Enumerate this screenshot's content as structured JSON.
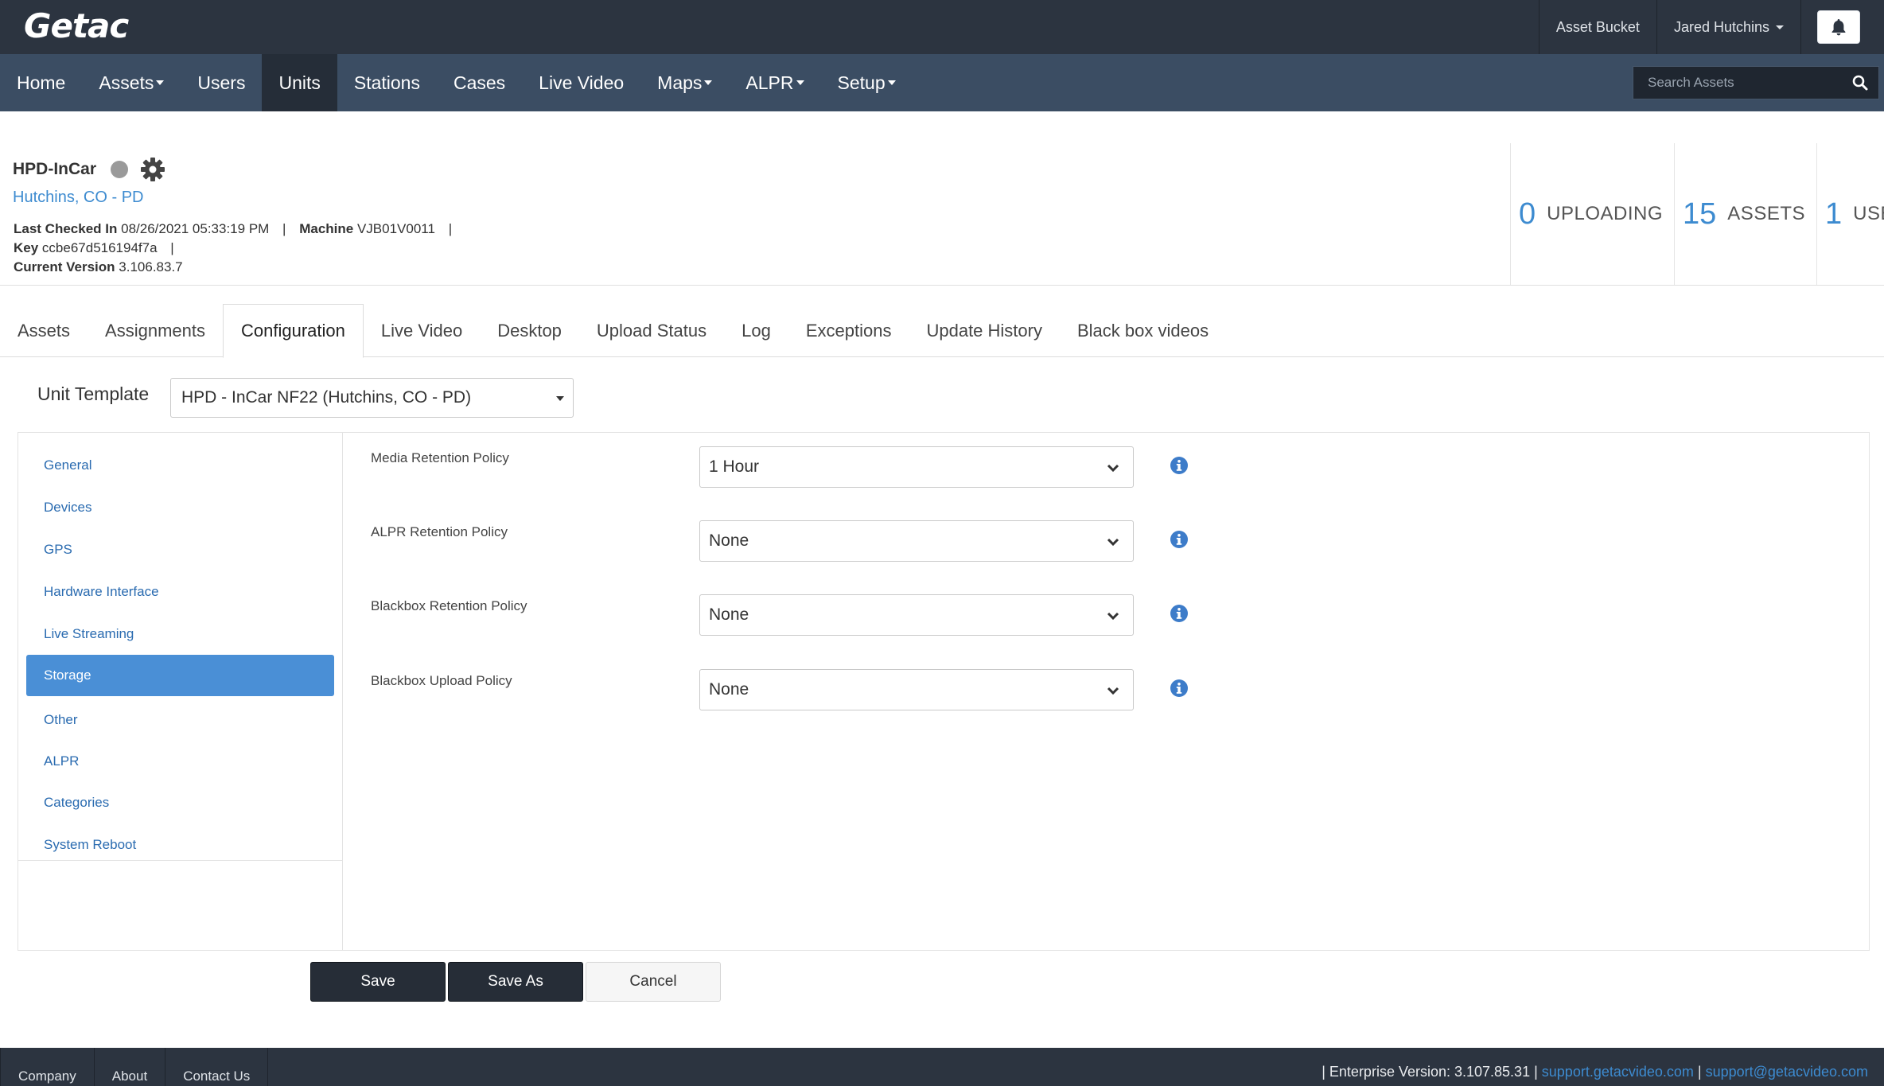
{
  "brand": {
    "logo": "Getac"
  },
  "topbar": {
    "asset_bucket": "Asset Bucket",
    "user_name": "Jared Hutchins",
    "bell_icon": "bell-icon"
  },
  "nav": {
    "items": [
      {
        "label": "Home",
        "dropdown": false,
        "active": false
      },
      {
        "label": "Assets",
        "dropdown": true,
        "active": false
      },
      {
        "label": "Users",
        "dropdown": false,
        "active": false
      },
      {
        "label": "Units",
        "dropdown": false,
        "active": true
      },
      {
        "label": "Stations",
        "dropdown": false,
        "active": false
      },
      {
        "label": "Cases",
        "dropdown": false,
        "active": false
      },
      {
        "label": "Live Video",
        "dropdown": false,
        "active": false
      },
      {
        "label": "Maps",
        "dropdown": true,
        "active": false
      },
      {
        "label": "ALPR",
        "dropdown": true,
        "active": false
      },
      {
        "label": "Setup",
        "dropdown": true,
        "active": false
      }
    ],
    "search_placeholder": "Search Assets"
  },
  "unit": {
    "name": "HPD-InCar",
    "org": "Hutchins, CO - PD",
    "last_checked_label": "Last Checked In",
    "last_checked_value": "08/26/2021 05:33:19 PM",
    "machine_label": "Machine",
    "machine_value": "VJB01V0011",
    "key_label": "Key",
    "key_value": "ccbe67d516194f7a",
    "version_label": "Current Version",
    "version_value": "3.106.83.7",
    "separator": "|"
  },
  "stats": [
    {
      "value": "0",
      "label": "UPLOADING"
    },
    {
      "value": "15",
      "label": "ASSETS"
    },
    {
      "value": "1",
      "label": "USERS"
    }
  ],
  "tabs": [
    {
      "label": "Assets",
      "active": false
    },
    {
      "label": "Assignments",
      "active": false
    },
    {
      "label": "Configuration",
      "active": true
    },
    {
      "label": "Live Video",
      "active": false
    },
    {
      "label": "Desktop",
      "active": false
    },
    {
      "label": "Upload Status",
      "active": false
    },
    {
      "label": "Log",
      "active": false
    },
    {
      "label": "Exceptions",
      "active": false
    },
    {
      "label": "Update History",
      "active": false
    },
    {
      "label": "Black box videos",
      "active": false
    }
  ],
  "template": {
    "label": "Unit Template",
    "value": "HPD - InCar NF22 (Hutchins, CO - PD)"
  },
  "config_menu": [
    {
      "label": "General",
      "active": false
    },
    {
      "label": "Devices",
      "active": false
    },
    {
      "label": "GPS",
      "active": false
    },
    {
      "label": "Hardware Interface",
      "active": false
    },
    {
      "label": "Live Streaming",
      "active": false
    },
    {
      "label": "Storage",
      "active": true
    },
    {
      "label": "Other",
      "active": false
    },
    {
      "label": "ALPR",
      "active": false
    },
    {
      "label": "Categories",
      "active": false
    },
    {
      "label": "System Reboot",
      "active": false
    }
  ],
  "storage_fields": [
    {
      "label": "Media Retention Policy",
      "value": "1 Hour"
    },
    {
      "label": "ALPR Retention Policy",
      "value": "None"
    },
    {
      "label": "Blackbox Retention Policy",
      "value": "None"
    },
    {
      "label": "Blackbox Upload Policy",
      "value": "None"
    }
  ],
  "actions": {
    "save": "Save",
    "save_as": "Save As",
    "cancel": "Cancel"
  },
  "footer": {
    "links": [
      "Company",
      "About",
      "Contact Us"
    ],
    "version_text": "| Enterprise Version: 3.107.85.31 |",
    "support_site": "support.getacvideo.com",
    "pipe": "|",
    "support_email": "support@getacvideo.com"
  },
  "colors": {
    "topbar": "#2c3440",
    "navbar": "#3b4d63",
    "nav_active": "#252d38",
    "accent": "#3d8bd0",
    "menu_active": "#4a8fd6",
    "button_dark": "#262d37"
  }
}
